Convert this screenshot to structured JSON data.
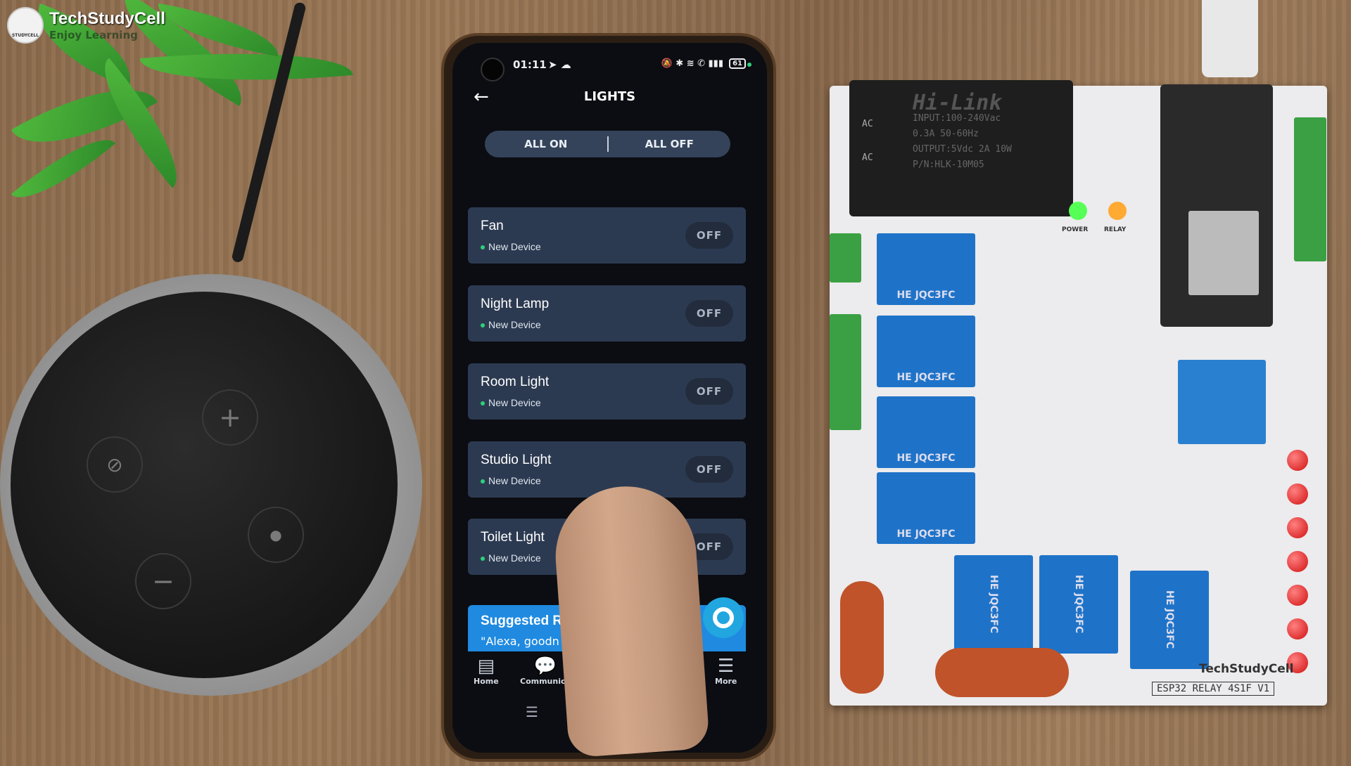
{
  "watermark": {
    "title": "TechStudyCell",
    "subtitle": "Enjoy Learning",
    "logo_text": "STUDYCELL"
  },
  "phone": {
    "status_bar": {
      "time": "01:11",
      "battery": "61"
    },
    "header": {
      "title": "LIGHTS",
      "back_icon": "arrow-left-icon"
    },
    "segmented": {
      "all_on": "ALL ON",
      "all_off": "ALL OFF"
    },
    "devices": [
      {
        "name": "Fan",
        "subtitle": "New Device",
        "state": "OFF"
      },
      {
        "name": "Night Lamp",
        "subtitle": "New Device",
        "state": "OFF"
      },
      {
        "name": "Room Light",
        "subtitle": "New Device",
        "state": "OFF"
      },
      {
        "name": "Studio Light",
        "subtitle": "New Device",
        "state": "OFF"
      },
      {
        "name": "Toilet Light",
        "subtitle": "New Device",
        "state": "OFF"
      }
    ],
    "banner": {
      "title": "Suggested Ro",
      "quote": "\"Alexa, goodn"
    },
    "bottom_nav": [
      {
        "label": "Home",
        "icon": "home-icon"
      },
      {
        "label": "Communica",
        "icon": "chat-bubble-icon"
      },
      {
        "label": "More",
        "icon": "menu-icon"
      }
    ],
    "colors": {
      "card": "#2c3a51",
      "accent": "#1f8ae0",
      "online_dot": "#2fd07a"
    }
  },
  "board": {
    "hilink_brand": "Hi-Link",
    "hilink_lines": [
      "INPUT:100-240Vac",
      "0.3A 50-60Hz",
      "OUTPUT:5Vdc 2A 10W",
      "P/N:HLK-10M05"
    ],
    "ac_label": "AC",
    "relay_label": "HE JQC3FC",
    "power_label": "POWER",
    "relay_led_label": "RELAY",
    "brand": "TechStudyCell",
    "model": "ESP32 RELAY 4S1F V1"
  }
}
